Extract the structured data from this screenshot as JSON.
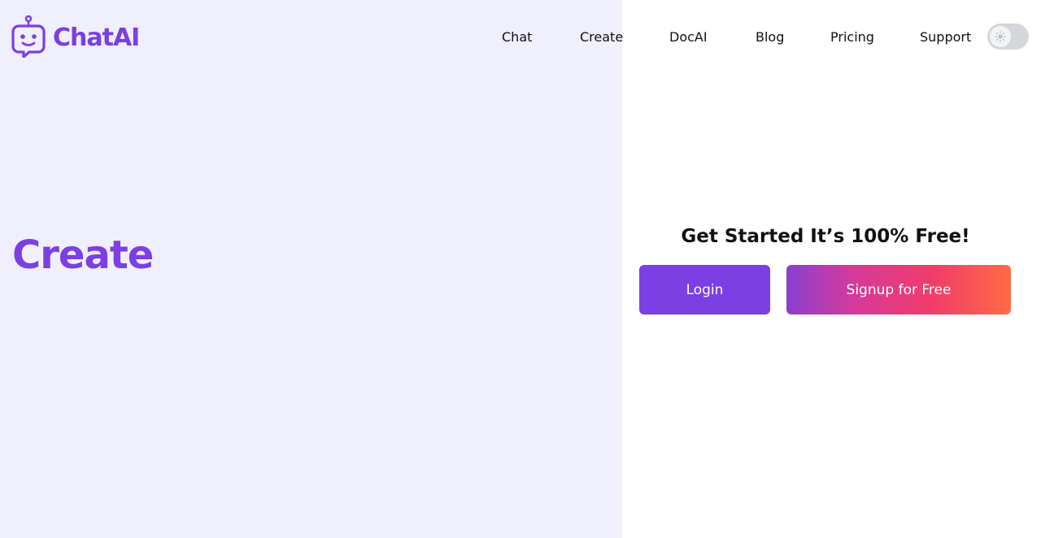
{
  "brand": {
    "name": "ChatAI",
    "color": "#7b3fe4"
  },
  "nav": {
    "links": [
      {
        "label": "Chat"
      },
      {
        "label": "Create"
      },
      {
        "label": "DocAI"
      },
      {
        "label": "Blog"
      },
      {
        "label": "Pricing"
      },
      {
        "label": "Support"
      }
    ],
    "theme_toggle_icon": "sun-icon"
  },
  "hero": {
    "title": "Create"
  },
  "cta": {
    "heading": "Get Started It’s 100% Free!",
    "login_label": "Login",
    "signup_label": "Signup for Free"
  },
  "colors": {
    "left_background": "#efeffd",
    "accent": "#7b3fe4",
    "signup_gradient": [
      "#8a3fd0",
      "#f13c6a",
      "#ff6b45"
    ]
  }
}
